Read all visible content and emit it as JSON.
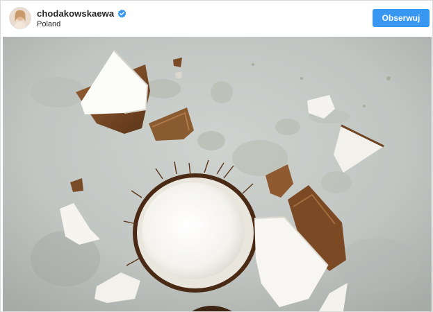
{
  "post": {
    "username": "chodakowskaewa",
    "location": "Poland",
    "follow_label": "Obserwuj",
    "verified": true,
    "avatar_icon": "profile-avatar",
    "photo_subject": "cracked-coconut-pieces-on-concrete"
  },
  "colors": {
    "follow_button": "#3897f0",
    "verified_badge": "#3897f0",
    "username_text": "#262626"
  }
}
